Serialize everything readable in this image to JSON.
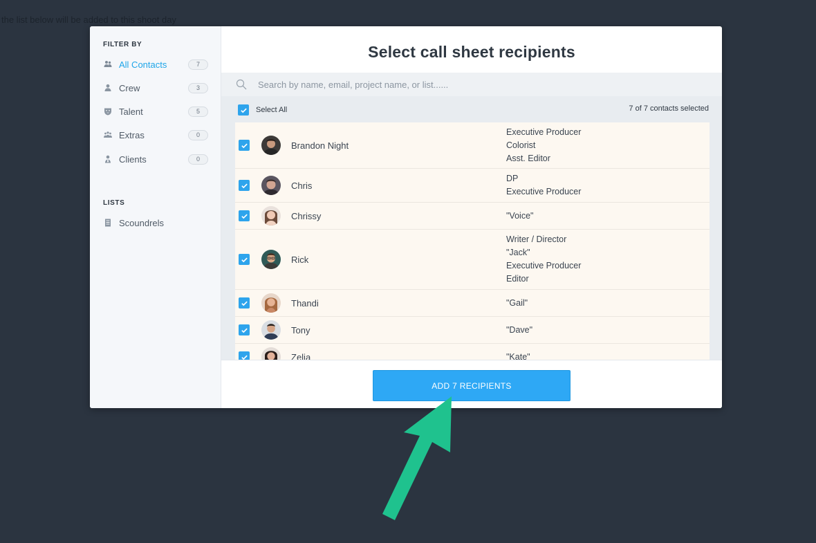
{
  "background_text": "the list below will be added to this shoot day",
  "sidebar": {
    "filter_heading": "FILTER BY",
    "filters": [
      {
        "label": "All Contacts",
        "count": "7",
        "icon": "group-icon",
        "active": true
      },
      {
        "label": "Crew",
        "count": "3",
        "icon": "person-icon",
        "active": false
      },
      {
        "label": "Talent",
        "count": "5",
        "icon": "mask-icon",
        "active": false
      },
      {
        "label": "Extras",
        "count": "0",
        "icon": "crowd-icon",
        "active": false
      },
      {
        "label": "Clients",
        "count": "0",
        "icon": "client-icon",
        "active": false
      }
    ],
    "lists_heading": "LISTS",
    "lists": [
      {
        "label": "Scoundrels",
        "icon": "list-icon"
      }
    ]
  },
  "main": {
    "title": "Select call sheet recipients",
    "search": {
      "placeholder": "Search by name, email, project name, or list......",
      "value": ""
    },
    "select_all_label": "Select All",
    "selected_count": "7 of 7 contacts selected",
    "contacts": [
      {
        "name": "Brandon Night",
        "roles": [
          "Executive Producer",
          "Colorist",
          "Asst. Editor"
        ],
        "checked": true
      },
      {
        "name": "Chris",
        "roles": [
          "DP",
          "Executive Producer"
        ],
        "checked": true
      },
      {
        "name": "Chrissy",
        "roles": [
          "\"Voice\""
        ],
        "checked": true
      },
      {
        "name": "Rick",
        "roles": [
          "Writer / Director",
          "\"Jack\"",
          "Executive Producer",
          "Editor"
        ],
        "checked": true
      },
      {
        "name": "Thandi",
        "roles": [
          "\"Gail\""
        ],
        "checked": true
      },
      {
        "name": "Tony",
        "roles": [
          "\"Dave\""
        ],
        "checked": true
      },
      {
        "name": "Zelia",
        "roles": [
          "\"Kate\""
        ],
        "checked": true
      }
    ],
    "add_button_label": "ADD 7 RECIPIENTS"
  },
  "colors": {
    "accent": "#2ea8f5",
    "arrow": "#1fc28e",
    "backdrop": "#2b3440",
    "row_background": "#fdf8f1"
  }
}
